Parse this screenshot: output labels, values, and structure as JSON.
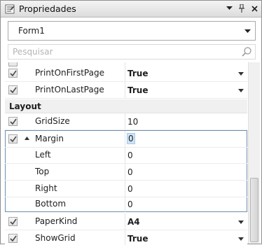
{
  "window": {
    "title": "Propriedades",
    "buttons": [
      "dropdown",
      "pin",
      "close"
    ]
  },
  "selector": {
    "value": "Form1"
  },
  "search": {
    "placeholder": "Pesquisar",
    "value": ""
  },
  "grid": {
    "rows_top": [
      {
        "name": "PrintOnFirstPage",
        "value": "True",
        "checked": true,
        "dropdown": true
      },
      {
        "name": "PrintOnLastPage",
        "value": "True",
        "checked": true,
        "dropdown": true
      }
    ],
    "category": "Layout",
    "gridsize": {
      "name": "GridSize",
      "value": "10",
      "checked": true
    },
    "margin": {
      "name": "Margin",
      "value": "0",
      "checked": true,
      "expanded": true,
      "children": [
        {
          "name": "Left",
          "value": "0"
        },
        {
          "name": "Top",
          "value": "0"
        },
        {
          "name": "Right",
          "value": "0"
        },
        {
          "name": "Bottom",
          "value": "0"
        }
      ]
    },
    "rows_bottom": [
      {
        "name": "PaperKind",
        "value": "A4",
        "checked": true,
        "dropdown": true
      },
      {
        "name": "ShowGrid",
        "value": "True",
        "checked": true,
        "dropdown": true
      }
    ]
  },
  "colors": {
    "accent": "#6c8fb0",
    "selection": "#cfe3f7"
  }
}
